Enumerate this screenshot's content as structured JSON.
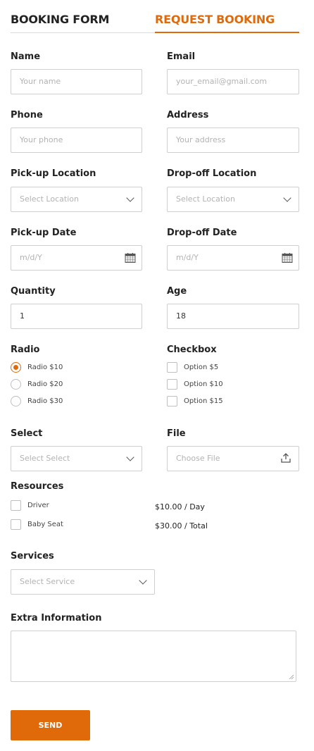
{
  "tabs": {
    "booking": "BOOKING FORM",
    "request": "REQUEST BOOKING"
  },
  "name": {
    "label": "Name",
    "placeholder": "Your name"
  },
  "email": {
    "label": "Email",
    "placeholder": "your_email@gmail.com"
  },
  "phone": {
    "label": "Phone",
    "placeholder": "Your phone"
  },
  "address": {
    "label": "Address",
    "placeholder": "Your address"
  },
  "pickup_location": {
    "label": "Pick-up Location",
    "placeholder": "Select Location"
  },
  "dropoff_location": {
    "label": "Drop-off Location",
    "placeholder": "Select Location"
  },
  "pickup_date": {
    "label": "Pick-up Date",
    "placeholder": "m/d/Y"
  },
  "dropoff_date": {
    "label": "Drop-off Date",
    "placeholder": "m/d/Y"
  },
  "quantity": {
    "label": "Quantity",
    "value": "1"
  },
  "age": {
    "label": "Age",
    "value": "18"
  },
  "radio": {
    "label": "Radio",
    "options": [
      "Radio $10",
      "Radio $20",
      "Radio $30"
    ],
    "selected_index": 0
  },
  "checkbox": {
    "label": "Checkbox",
    "options": [
      "Option $5",
      "Option $10",
      "Option $15"
    ]
  },
  "select": {
    "label": "Select",
    "placeholder": "Select Select"
  },
  "file": {
    "label": "File",
    "placeholder": "Choose File"
  },
  "resources": {
    "label": "Resources",
    "items": [
      {
        "name": "Driver",
        "price": "$10.00 / Day"
      },
      {
        "name": "Baby Seat",
        "price": "$30.00 / Total"
      }
    ]
  },
  "services": {
    "label": "Services",
    "placeholder": "Select Service"
  },
  "extra": {
    "label": "Extra Information"
  },
  "send": {
    "label": "SEND"
  },
  "colors": {
    "accent": "#e06a0a",
    "border": "#cfcfcf",
    "placeholder": "#b3b3b3"
  },
  "icons": {
    "dropdown": "chevron-down-icon",
    "date": "calendar-icon",
    "file": "upload-icon"
  }
}
